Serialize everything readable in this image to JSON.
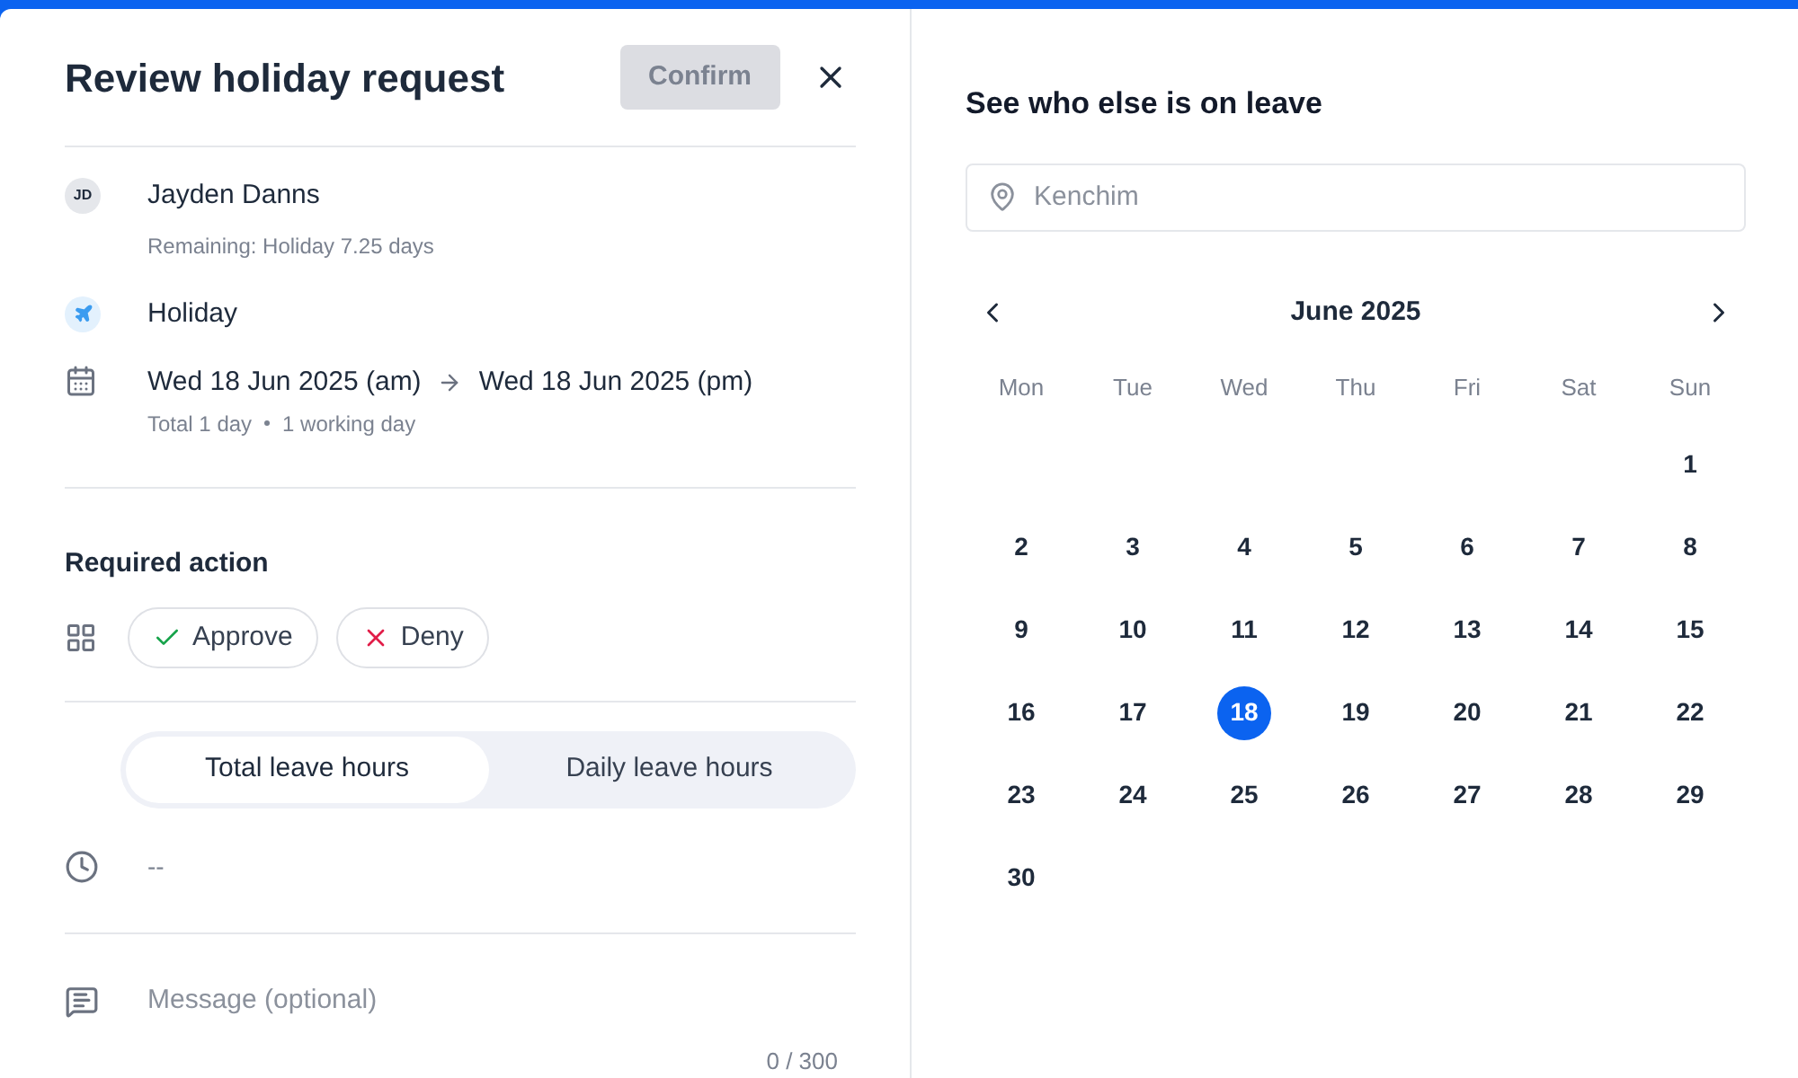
{
  "header": {
    "title": "Review holiday request",
    "confirm": {
      "label": "Confirm",
      "disabled": true
    }
  },
  "employee": {
    "initials": "JD",
    "name": "Jayden Danns",
    "remaining": "Remaining: Holiday 7.25 days"
  },
  "leave_type": "Holiday",
  "dates": {
    "start": "Wed 18 Jun 2025 (am)",
    "end": "Wed 18 Jun 2025 (pm)",
    "total": "Total 1 day",
    "working": "1 working day"
  },
  "required_action": {
    "title": "Required action",
    "buttons": [
      {
        "kind": "approve",
        "label": "Approve"
      },
      {
        "kind": "deny",
        "label": "Deny"
      }
    ]
  },
  "hours_tabs": [
    {
      "label": "Total leave hours",
      "selected": true
    },
    {
      "label": "Daily leave hours",
      "selected": false
    }
  ],
  "hours_value": "--",
  "message": {
    "placeholder": "Message (optional)",
    "counter": "0 / 300"
  },
  "calendar": {
    "title": "See who else is on leave",
    "location": {
      "placeholder": "Kenchim"
    },
    "month": "June 2025",
    "weekdays": [
      "Mon",
      "Tue",
      "Wed",
      "Thu",
      "Fri",
      "Sat",
      "Sun"
    ],
    "days": [
      {
        "label": "1",
        "selected": false
      },
      {
        "label": "2",
        "selected": false
      },
      {
        "label": "3",
        "selected": false
      },
      {
        "label": "4",
        "selected": false
      },
      {
        "label": "5",
        "selected": false
      },
      {
        "label": "6",
        "selected": false
      },
      {
        "label": "7",
        "selected": false
      },
      {
        "label": "8",
        "selected": false
      },
      {
        "label": "9",
        "selected": false
      },
      {
        "label": "10",
        "selected": false
      },
      {
        "label": "11",
        "selected": false
      },
      {
        "label": "12",
        "selected": false
      },
      {
        "label": "13",
        "selected": false
      },
      {
        "label": "14",
        "selected": false
      },
      {
        "label": "15",
        "selected": false
      },
      {
        "label": "16",
        "selected": false
      },
      {
        "label": "17",
        "selected": false
      },
      {
        "label": "18",
        "selected": true
      },
      {
        "label": "19",
        "selected": false
      },
      {
        "label": "20",
        "selected": false
      },
      {
        "label": "21",
        "selected": false
      },
      {
        "label": "22",
        "selected": false
      },
      {
        "label": "23",
        "selected": false
      },
      {
        "label": "24",
        "selected": false
      },
      {
        "label": "25",
        "selected": false
      },
      {
        "label": "26",
        "selected": false
      },
      {
        "label": "27",
        "selected": false
      },
      {
        "label": "28",
        "selected": false
      },
      {
        "label": "29",
        "selected": false
      },
      {
        "label": "30",
        "selected": false
      }
    ]
  }
}
